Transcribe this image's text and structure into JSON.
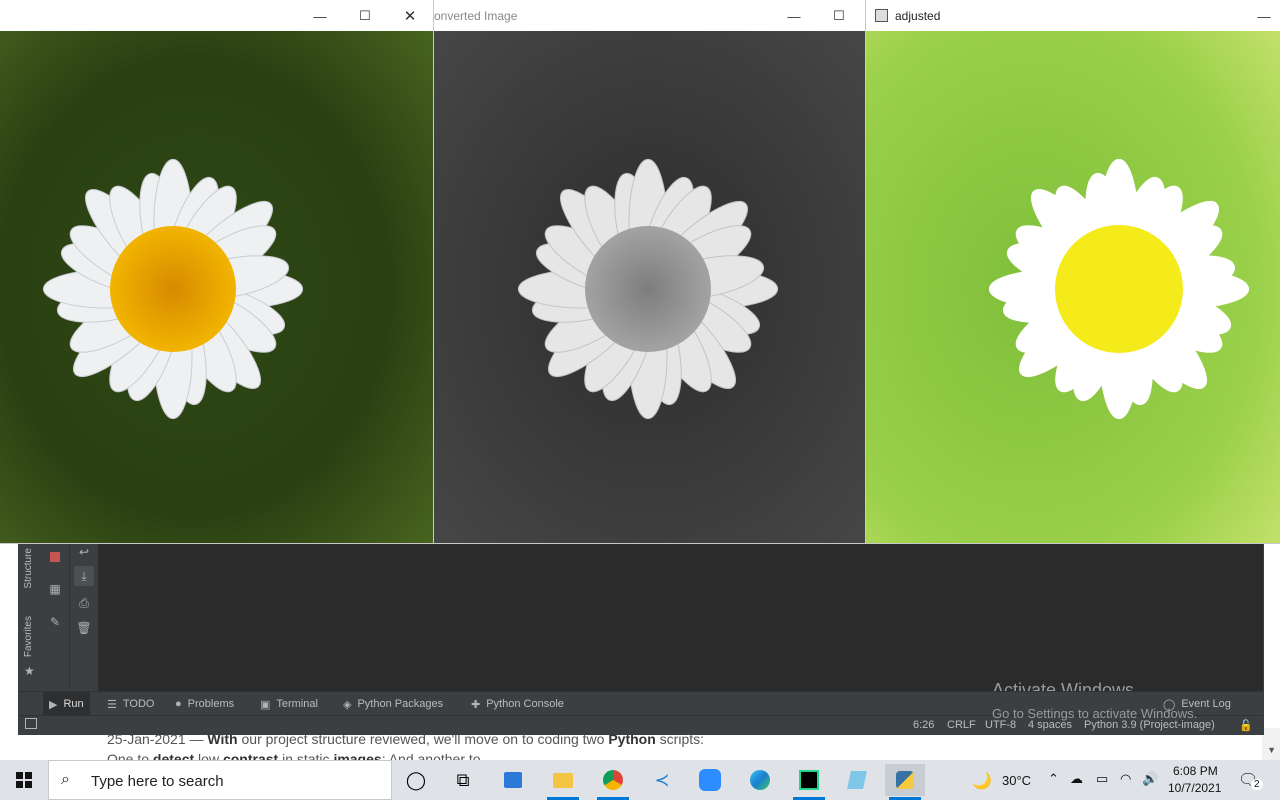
{
  "windows": {
    "original": {
      "title": ""
    },
    "converted": {
      "title": "onverted Image"
    },
    "adjusted": {
      "title": "adjusted"
    }
  },
  "ide": {
    "side_tabs": [
      "Structure",
      "Favorites"
    ],
    "bottom_tabs": [
      {
        "label": "Run",
        "icon": "play-icon"
      },
      {
        "label": "TODO",
        "icon": "list-icon"
      },
      {
        "label": "Problems",
        "icon": "info-icon"
      },
      {
        "label": "Terminal",
        "icon": "terminal-icon"
      },
      {
        "label": "Python Packages",
        "icon": "layers-icon"
      },
      {
        "label": "Python Console",
        "icon": "python-icon"
      }
    ],
    "event_log": "Event Log",
    "status": {
      "position": "6:26",
      "line_sep": "CRLF",
      "encoding": "UTF-8",
      "indent": "4 spaces",
      "interpreter": "Python 3.9 (Project-image)"
    },
    "watermark": {
      "line1": "Activate Windows",
      "line2": "Go to Settings to activate Windows."
    }
  },
  "background": {
    "line1_date": "25-Jan-2021 — ",
    "line1_b1": "With",
    "line1_mid": " our project structure reviewed, we'll move on to coding two ",
    "line1_b2": "Python",
    "line1_end": " scripts:",
    "line2_a": "One to ",
    "line2_b1": "detect",
    "line2_mid": " low ",
    "line2_b2": "contrast",
    "line2_mid2": " in static ",
    "line2_b3": "images",
    "line2_end": "; And another to"
  },
  "taskbar": {
    "search_placeholder": "Type here to search",
    "weather": "30°C",
    "time": "6:08 PM",
    "date": "10/7/2021",
    "notifications": "2",
    "apps": [
      "cortana-icon",
      "task-view-icon",
      "store-icon",
      "file-explorer-icon",
      "chrome-icon",
      "vscode-icon",
      "zoom-icon",
      "edge-icon",
      "pycharm-icon",
      "notes-icon",
      "python-icon"
    ]
  },
  "colors": {
    "ide_bg": "#2b2b2b",
    "ide_panel": "#3c3f41",
    "taskbar": "#dfe3e8",
    "accent": "#0078d7"
  }
}
